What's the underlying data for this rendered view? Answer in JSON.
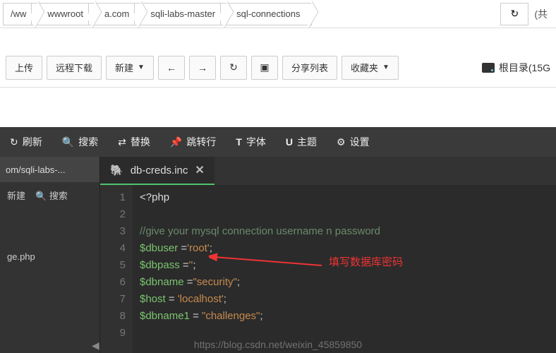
{
  "breadcrumb": {
    "items": [
      "/ww",
      "wwwroot",
      "a.com",
      "sqli-labs-master",
      "sql-connections"
    ],
    "extra": "(共"
  },
  "toolbar": {
    "upload": "上传",
    "remote": "远程下载",
    "new": "新建",
    "share": "分享列表",
    "fav": "收藏夹",
    "rootdir": "根目录(15G"
  },
  "editor_toolbar": {
    "refresh": "刷新",
    "search": "搜索",
    "replace": "替换",
    "goto": "跳转行",
    "font": "字体",
    "theme": "主题",
    "settings": "设置"
  },
  "sidebar": {
    "tab": "om/sqli-labs-...",
    "new": "新建",
    "search": "搜索",
    "file": "ge.php"
  },
  "tab": {
    "name": "db-creds.inc"
  },
  "code": {
    "lines": [
      "1",
      "2",
      "3",
      "4",
      "5",
      "6",
      "7",
      "8",
      "9"
    ],
    "l1": "<?php",
    "l3": "//give your mysql connection username n password",
    "l4_var": "$dbuser ",
    "l4_eq": "=",
    "l4_str": "'root'",
    "l4_end": ";",
    "l5_var": "$dbpass ",
    "l5_eq": "=",
    "l5_str": "''",
    "l5_end": ";",
    "l6_var": "$dbname ",
    "l6_eq": "=",
    "l6_str": "\"security\"",
    "l6_end": ";",
    "l7_var": "$host ",
    "l7_eq": "= ",
    "l7_str": "'localhost'",
    "l7_end": ";",
    "l8_var": "$dbname1 ",
    "l8_eq": "= ",
    "l8_str": "\"challenges\"",
    "l8_end": ";"
  },
  "annotation": "填写数据库密码",
  "watermark": "https://blog.csdn.net/weixin_45859850"
}
